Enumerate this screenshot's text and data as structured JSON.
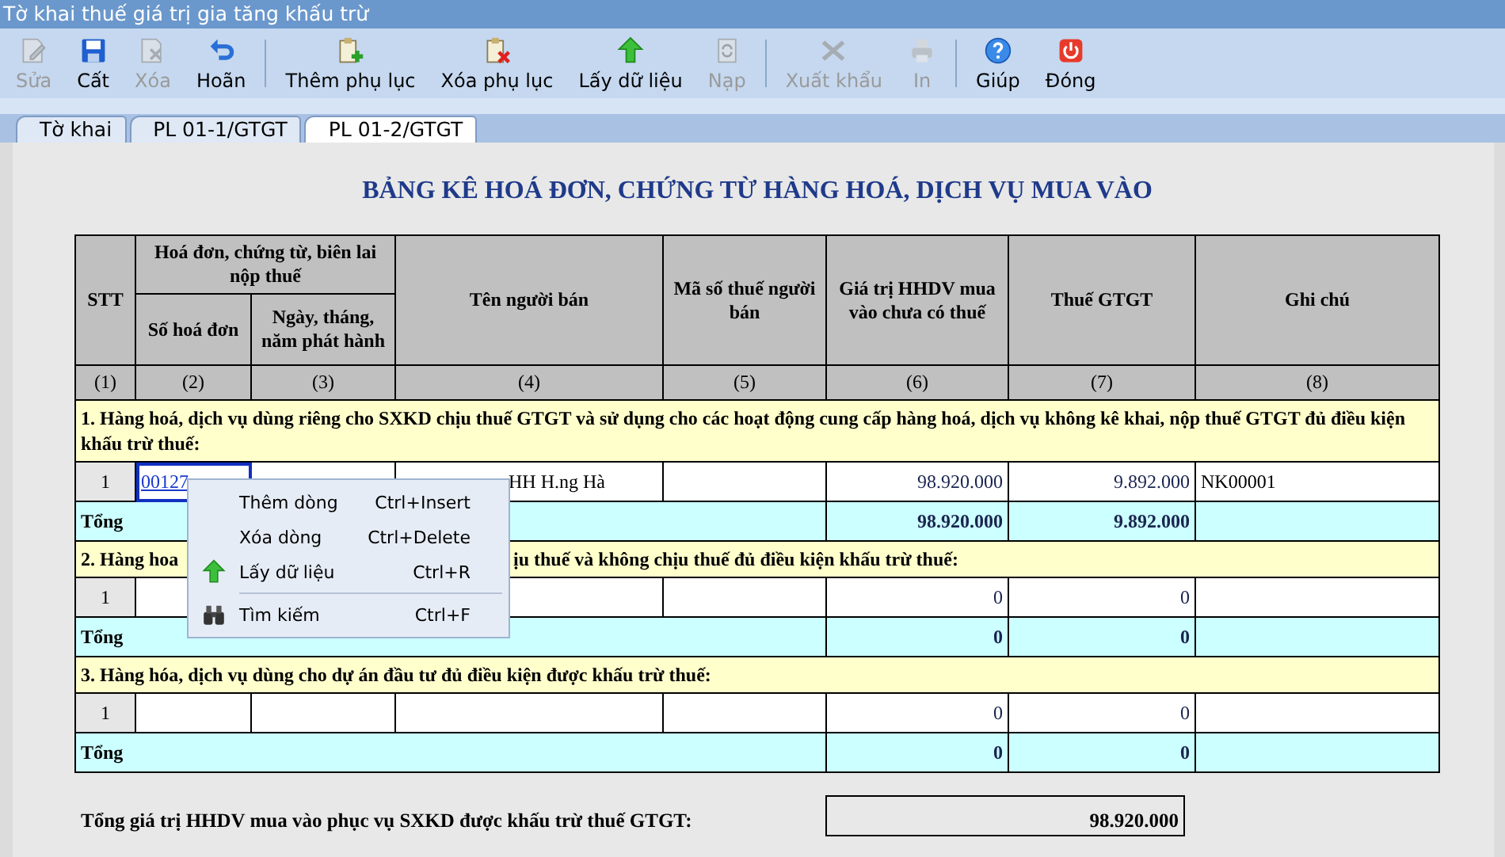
{
  "window": {
    "title": "Tờ khai thuế giá trị gia tăng khấu trừ"
  },
  "toolbar": {
    "groups": [
      [
        {
          "label": "Sửa",
          "disabled": true
        },
        {
          "label": "Cất",
          "disabled": false
        },
        {
          "label": "Xóa",
          "disabled": true
        },
        {
          "label": "Hoãn",
          "disabled": false
        }
      ],
      [
        {
          "label": "Thêm phụ lục",
          "disabled": false
        },
        {
          "label": "Xóa phụ lục",
          "disabled": false
        },
        {
          "label": "Lấy dữ liệu",
          "disabled": false
        },
        {
          "label": "Nạp",
          "disabled": true
        }
      ],
      [
        {
          "label": "Xuất khẩu",
          "disabled": true
        },
        {
          "label": "In",
          "disabled": true
        }
      ],
      [
        {
          "label": "Giúp",
          "disabled": false
        },
        {
          "label": "Đóng",
          "disabled": false
        }
      ]
    ]
  },
  "tabs": [
    {
      "label": "Tờ khai",
      "selected": false
    },
    {
      "label": "PL 01-1/GTGT",
      "selected": false
    },
    {
      "label": "PL 01-2/GTGT",
      "selected": true
    }
  ],
  "form_title": "BẢNG KÊ HOÁ ĐƠN, CHỨNG TỪ HÀNG HOÁ, DỊCH VỤ MUA VÀO",
  "table": {
    "header": {
      "stt": "STT",
      "invoice_group": "Hoá đơn, chứng từ, biên lai nộp thuế",
      "invoice_no": "Số hoá đơn",
      "invoice_date": "Ngày, tháng, năm phát hành",
      "seller": "Tên người bán",
      "tax_code": "Mã số thuế người bán",
      "value": "Giá trị HHDV mua vào chưa có thuế",
      "tax": "Thuế GTGT",
      "note": "Ghi chú"
    },
    "column_numbers": [
      "(1)",
      "(2)",
      "(3)",
      "(4)",
      "(5)",
      "(6)",
      "(7)",
      "(8)"
    ],
    "sections": [
      {
        "title_fragments": [
          "1. Hàng hoá, dịch vụ dùng riêng cho SXKD chịu thuế GTGT và sử dụng cho các hoạt động cung cấp hàng hoá, dịch vụ không kê khai, nộp thuế GTGT đủ điều kiện khấu trừ thuế:"
        ],
        "rows": [
          {
            "stt": "1",
            "invoice": "00127",
            "seller": "HH H.ng Hà",
            "value": "98.920.000",
            "tax": "9.892.000",
            "note": "NK00001",
            "focused": true
          }
        ],
        "total": {
          "label": "Tổng",
          "value": "98.920.000",
          "tax": "9.892.000"
        }
      },
      {
        "title_fragments": [
          "2. Hàng hoa",
          "ịu thuế và không chịu thuế đủ điều kiện khấu trừ thuế:"
        ],
        "rows": [
          {
            "stt": "1",
            "value": "0",
            "tax": "0",
            "focused": false
          }
        ],
        "total": {
          "label": "Tổng",
          "value": "0",
          "tax": "0"
        }
      },
      {
        "title_fragments": [
          "3. Hàng hóa, dịch vụ dùng cho dự án đầu tư đủ điều kiện được khấu trừ thuế:"
        ],
        "rows": [
          {
            "stt": "1",
            "value": "0",
            "tax": "0",
            "focused": false
          }
        ],
        "total": {
          "label": "Tổng",
          "value": "0",
          "tax": "0"
        }
      }
    ]
  },
  "summary": {
    "label": "Tổng giá trị HHDV mua vào phục vụ SXKD được khấu trừ thuế GTGT:",
    "value": "98.920.000"
  },
  "context_menu": {
    "items": [
      {
        "kind": "item",
        "label": "Thêm dòng",
        "shortcut": "Ctrl+Insert"
      },
      {
        "kind": "item",
        "label": "Xóa dòng",
        "shortcut": "Ctrl+Delete"
      },
      {
        "kind": "item",
        "label": "Lấy dữ liệu",
        "shortcut": "Ctrl+R"
      },
      {
        "kind": "separator"
      },
      {
        "kind": "item",
        "label": "Tìm kiếm",
        "shortcut": "Ctrl+F"
      }
    ]
  }
}
